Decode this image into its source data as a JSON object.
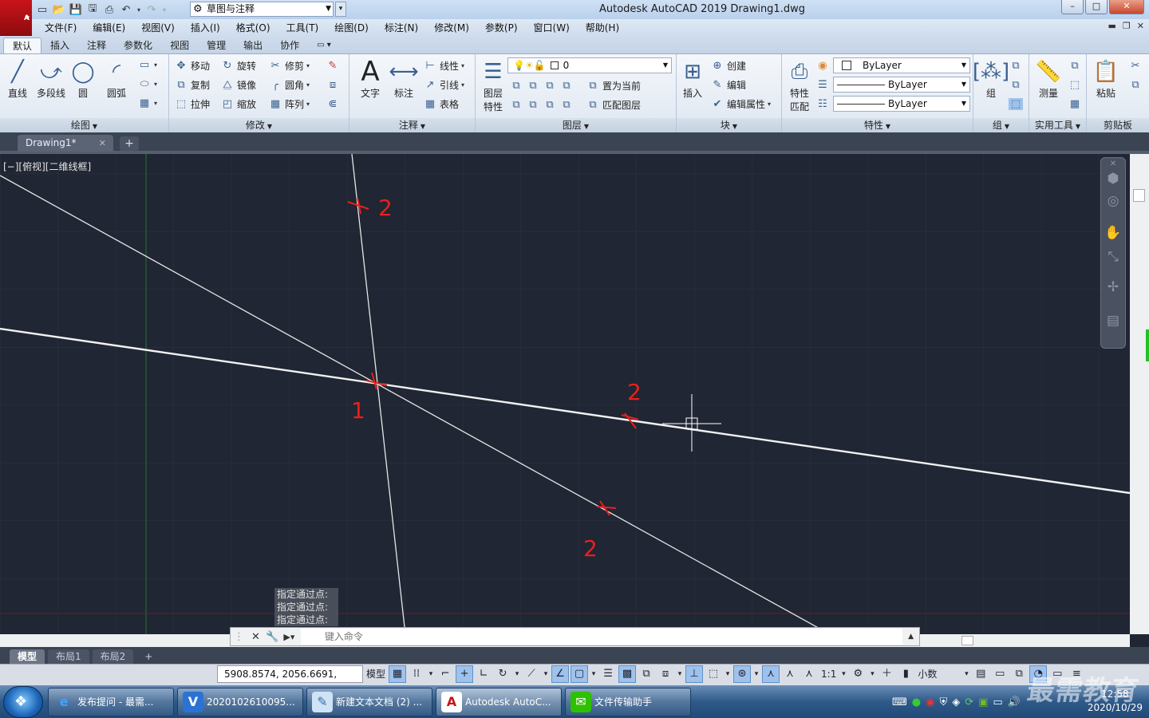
{
  "app": {
    "logo_letter": "A",
    "title": "Autodesk AutoCAD 2019    Drawing1.dwg",
    "workspace": "草图与注释"
  },
  "window_buttons": {
    "minimize": "–",
    "maximize": "□",
    "close": "✕"
  },
  "menus": [
    "文件(F)",
    "编辑(E)",
    "视图(V)",
    "插入(I)",
    "格式(O)",
    "工具(T)",
    "绘图(D)",
    "标注(N)",
    "修改(M)",
    "参数(P)",
    "窗口(W)",
    "帮助(H)"
  ],
  "ribbon_tabs": [
    "默认",
    "插入",
    "注释",
    "参数化",
    "视图",
    "管理",
    "输出",
    "协作"
  ],
  "ribbon_extra": "▭ ▾",
  "panels": {
    "draw": {
      "title": "绘图",
      "line": "直线",
      "polyline": "多段线",
      "circle": "圆",
      "arc": "圆弧"
    },
    "modify": {
      "title": "修改",
      "move": "移动",
      "rotate": "旋转",
      "trim": "修剪",
      "copy": "复制",
      "mirror": "镜像",
      "fillet": "圆角",
      "stretch": "拉伸",
      "scale": "缩放",
      "array": "阵列"
    },
    "annotation": {
      "title": "注释",
      "text": "文字",
      "dimension": "标注",
      "linear": "线性",
      "leader": "引线",
      "table": "表格"
    },
    "layers": {
      "title": "图层",
      "properties_1": "图层",
      "properties_2": "特性",
      "current_layer": "0",
      "set_current": "置为当前",
      "match_layer": "匹配图层"
    },
    "block": {
      "title": "块",
      "insert": "插入",
      "create": "创建",
      "edit": "编辑",
      "edit_attr": "编辑属性"
    },
    "properties": {
      "title": "特性",
      "match_1": "特性",
      "match_2": "匹配",
      "color": "ByLayer",
      "linetype": "ByLayer",
      "lineweight": "ByLayer"
    },
    "group": {
      "title": "组",
      "group": "组"
    },
    "utilities": {
      "title": "实用工具",
      "measure": "测量"
    },
    "clipboard": {
      "title": "剪贴板",
      "paste": "粘贴"
    }
  },
  "file_tab": {
    "name": "Drawing1*",
    "close": "✕",
    "new": "+"
  },
  "viewport_label": "[−][俯视][二维线框]",
  "annotations": {
    "intersection": "1",
    "pass_top": "2",
    "pass_right": "2",
    "pass_lower": "2"
  },
  "command": {
    "history": [
      "指定通过点:",
      "指定通过点:",
      "指定通过点:"
    ],
    "placeholder": "键入命令"
  },
  "layout_tabs": [
    "模型",
    "布局1",
    "布局2"
  ],
  "layout_add": "+",
  "status": {
    "coordinates": "5908.8574, 2056.6691, 0.0000",
    "model": "模型",
    "scale": "1:1",
    "units": "小数"
  },
  "taskbar": {
    "items": [
      "发布提问 - 最需...",
      "2020102610095...",
      "新建文本文档 (2) ...",
      "Autodesk AutoC...",
      "文件传输助手"
    ],
    "time": "12:58",
    "date": "2020/10/29"
  },
  "watermark": "最需教育",
  "colors": {
    "canvas": "#202633",
    "annotation_red": "#e8201c",
    "ucs_green": "#1f7a2e"
  }
}
